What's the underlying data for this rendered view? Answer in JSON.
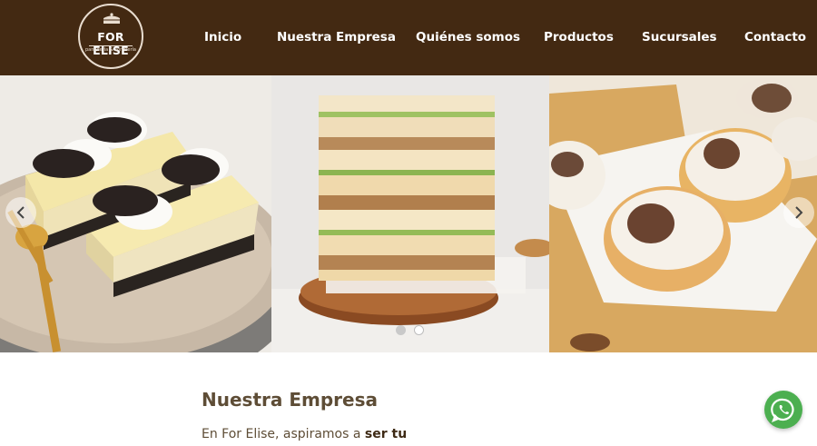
{
  "brand": {
    "name": "FOR ELISE",
    "tagline": "panadería & confitería"
  },
  "nav": {
    "items": [
      {
        "label": "Inicio"
      },
      {
        "label": "Nuestra Empresa"
      },
      {
        "label": "Quiénes somos"
      },
      {
        "label": "Productos"
      },
      {
        "label": "Sucursales"
      },
      {
        "label": "Contacto"
      }
    ]
  },
  "slider": {
    "slides": [
      {
        "subject": "oreo-cheesecake-bars"
      },
      {
        "subject": "layered-sandwiches"
      },
      {
        "subject": "dulce-de-leche-pastries"
      }
    ],
    "active_dot": 2,
    "dot_count": 2
  },
  "main": {
    "section_title": "Nuestra Empresa",
    "intro_text": "En For Elise, aspiramos a ",
    "intro_bold": "ser tu"
  },
  "colors": {
    "header_bg": "#432912",
    "heading_text": "#5e4d36",
    "whatsapp_green": "#4caf50"
  },
  "icons": {
    "logo": "cake-icon",
    "prev": "chevron-left-icon",
    "next": "chevron-right-icon",
    "chat": "whatsapp-icon"
  }
}
